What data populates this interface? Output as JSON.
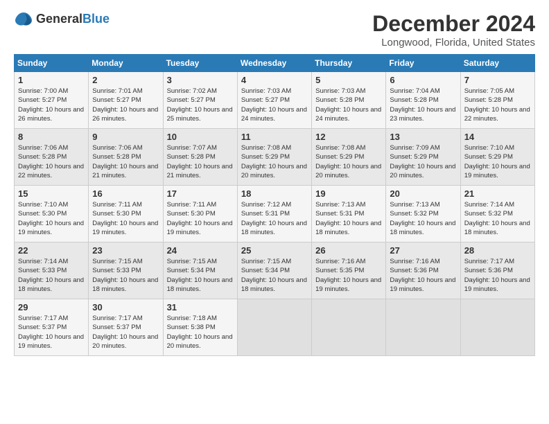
{
  "logo": {
    "general": "General",
    "blue": "Blue"
  },
  "title": "December 2024",
  "subtitle": "Longwood, Florida, United States",
  "header_accent": "#2a7ab5",
  "days_of_week": [
    "Sunday",
    "Monday",
    "Tuesday",
    "Wednesday",
    "Thursday",
    "Friday",
    "Saturday"
  ],
  "weeks": [
    [
      {
        "day": "1",
        "rise": "7:00 AM",
        "set": "5:27 PM",
        "daylight": "10 hours and 26 minutes."
      },
      {
        "day": "2",
        "rise": "7:01 AM",
        "set": "5:27 PM",
        "daylight": "10 hours and 26 minutes."
      },
      {
        "day": "3",
        "rise": "7:02 AM",
        "set": "5:27 PM",
        "daylight": "10 hours and 25 minutes."
      },
      {
        "day": "4",
        "rise": "7:03 AM",
        "set": "5:27 PM",
        "daylight": "10 hours and 24 minutes."
      },
      {
        "day": "5",
        "rise": "7:03 AM",
        "set": "5:28 PM",
        "daylight": "10 hours and 24 minutes."
      },
      {
        "day": "6",
        "rise": "7:04 AM",
        "set": "5:28 PM",
        "daylight": "10 hours and 23 minutes."
      },
      {
        "day": "7",
        "rise": "7:05 AM",
        "set": "5:28 PM",
        "daylight": "10 hours and 22 minutes."
      }
    ],
    [
      {
        "day": "8",
        "rise": "7:06 AM",
        "set": "5:28 PM",
        "daylight": "10 hours and 22 minutes."
      },
      {
        "day": "9",
        "rise": "7:06 AM",
        "set": "5:28 PM",
        "daylight": "10 hours and 21 minutes."
      },
      {
        "day": "10",
        "rise": "7:07 AM",
        "set": "5:28 PM",
        "daylight": "10 hours and 21 minutes."
      },
      {
        "day": "11",
        "rise": "7:08 AM",
        "set": "5:29 PM",
        "daylight": "10 hours and 20 minutes."
      },
      {
        "day": "12",
        "rise": "7:08 AM",
        "set": "5:29 PM",
        "daylight": "10 hours and 20 minutes."
      },
      {
        "day": "13",
        "rise": "7:09 AM",
        "set": "5:29 PM",
        "daylight": "10 hours and 20 minutes."
      },
      {
        "day": "14",
        "rise": "7:10 AM",
        "set": "5:29 PM",
        "daylight": "10 hours and 19 minutes."
      }
    ],
    [
      {
        "day": "15",
        "rise": "7:10 AM",
        "set": "5:30 PM",
        "daylight": "10 hours and 19 minutes."
      },
      {
        "day": "16",
        "rise": "7:11 AM",
        "set": "5:30 PM",
        "daylight": "10 hours and 19 minutes."
      },
      {
        "day": "17",
        "rise": "7:11 AM",
        "set": "5:30 PM",
        "daylight": "10 hours and 19 minutes."
      },
      {
        "day": "18",
        "rise": "7:12 AM",
        "set": "5:31 PM",
        "daylight": "10 hours and 18 minutes."
      },
      {
        "day": "19",
        "rise": "7:13 AM",
        "set": "5:31 PM",
        "daylight": "10 hours and 18 minutes."
      },
      {
        "day": "20",
        "rise": "7:13 AM",
        "set": "5:32 PM",
        "daylight": "10 hours and 18 minutes."
      },
      {
        "day": "21",
        "rise": "7:14 AM",
        "set": "5:32 PM",
        "daylight": "10 hours and 18 minutes."
      }
    ],
    [
      {
        "day": "22",
        "rise": "7:14 AM",
        "set": "5:33 PM",
        "daylight": "10 hours and 18 minutes."
      },
      {
        "day": "23",
        "rise": "7:15 AM",
        "set": "5:33 PM",
        "daylight": "10 hours and 18 minutes."
      },
      {
        "day": "24",
        "rise": "7:15 AM",
        "set": "5:34 PM",
        "daylight": "10 hours and 18 minutes."
      },
      {
        "day": "25",
        "rise": "7:15 AM",
        "set": "5:34 PM",
        "daylight": "10 hours and 18 minutes."
      },
      {
        "day": "26",
        "rise": "7:16 AM",
        "set": "5:35 PM",
        "daylight": "10 hours and 19 minutes."
      },
      {
        "day": "27",
        "rise": "7:16 AM",
        "set": "5:36 PM",
        "daylight": "10 hours and 19 minutes."
      },
      {
        "day": "28",
        "rise": "7:17 AM",
        "set": "5:36 PM",
        "daylight": "10 hours and 19 minutes."
      }
    ],
    [
      {
        "day": "29",
        "rise": "7:17 AM",
        "set": "5:37 PM",
        "daylight": "10 hours and 19 minutes."
      },
      {
        "day": "30",
        "rise": "7:17 AM",
        "set": "5:37 PM",
        "daylight": "10 hours and 20 minutes."
      },
      {
        "day": "31",
        "rise": "7:18 AM",
        "set": "5:38 PM",
        "daylight": "10 hours and 20 minutes."
      },
      null,
      null,
      null,
      null
    ]
  ]
}
